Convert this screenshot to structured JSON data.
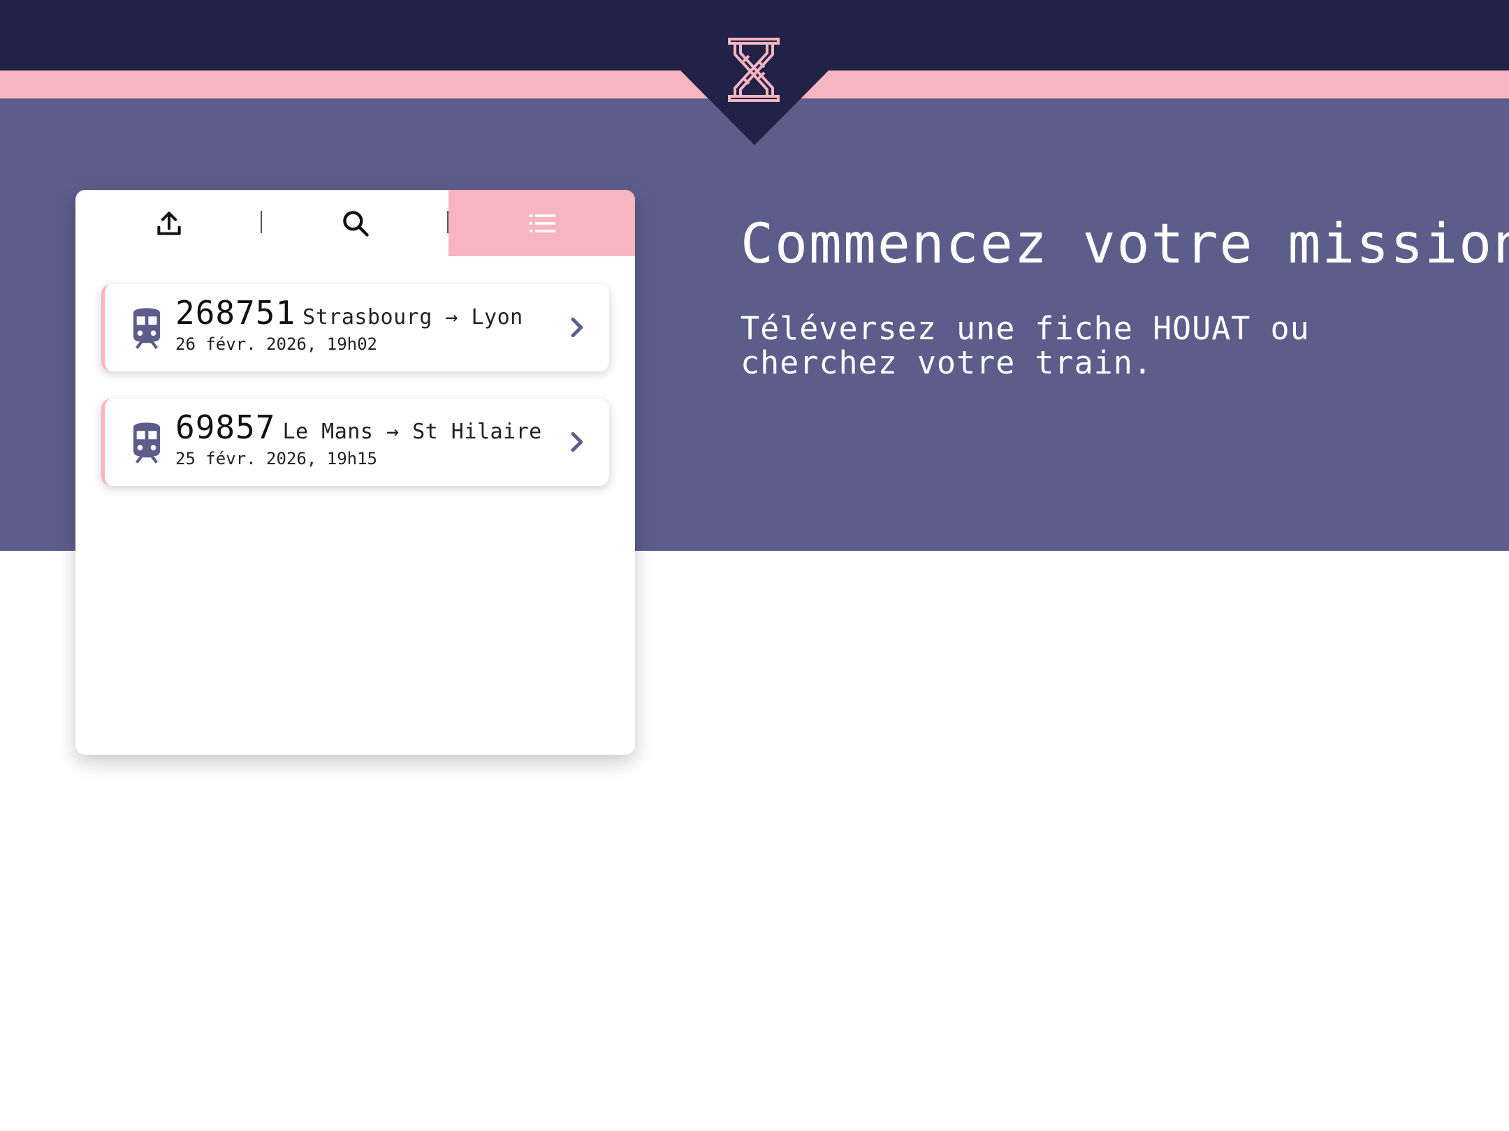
{
  "app": {
    "logo_icon": "hourglass-icon",
    "brand_color": "#222248",
    "accent_color": "#f7b5bf",
    "hero_color": "#5d5d8b"
  },
  "tabs": [
    {
      "icon": "upload-icon",
      "active": false
    },
    {
      "icon": "search-icon",
      "active": false
    },
    {
      "icon": "list-icon",
      "active": true
    }
  ],
  "trains": [
    {
      "number": "268751",
      "route": "Strasbourg → Lyon",
      "date": "26 févr. 2026, 19h02",
      "icon": "train-icon"
    },
    {
      "number": "69857",
      "route": "Le Mans → St Hilaire",
      "date": "25 févr. 2026, 19h15",
      "icon": "train-icon"
    }
  ],
  "hero": {
    "title": "Commencez votre mission",
    "subtitle": "Téléversez une fiche HOUAT ou cherchez votre train."
  }
}
